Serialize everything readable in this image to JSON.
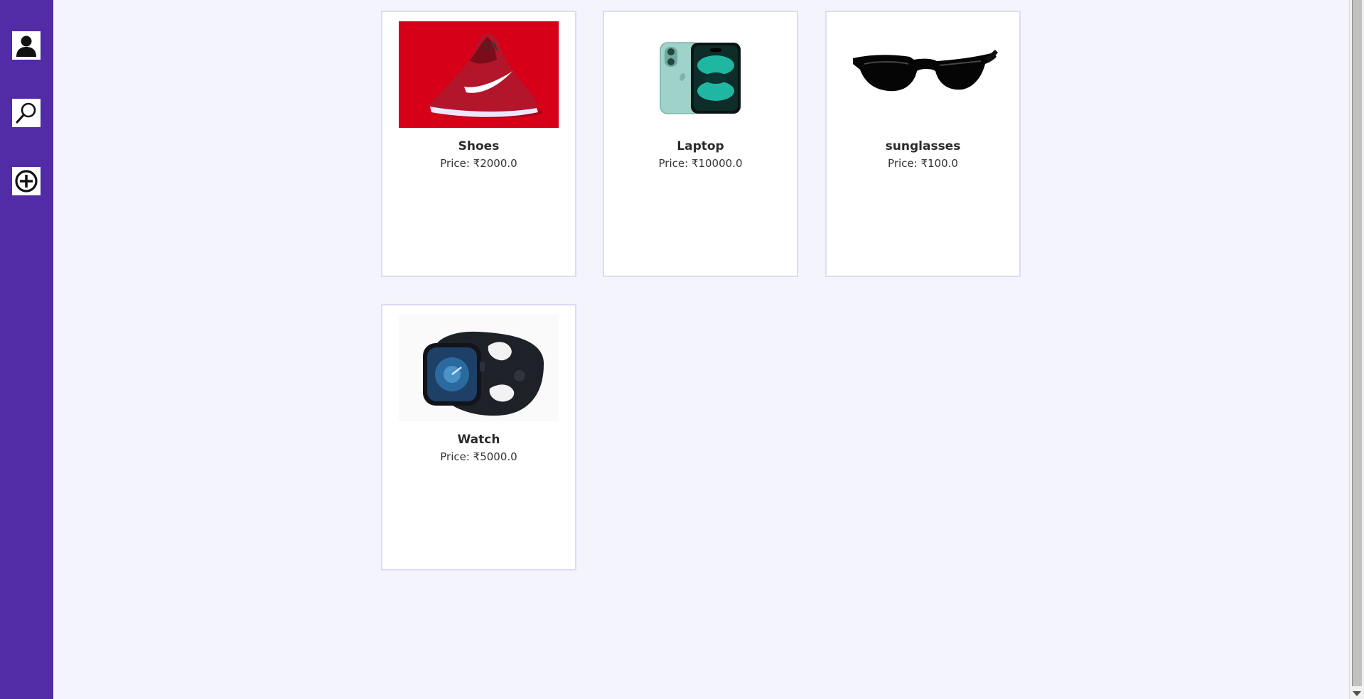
{
  "sidebar": {
    "accent_color": "#522ba7",
    "buttons": [
      {
        "icon": "user-icon",
        "name": "profile-button"
      },
      {
        "icon": "search-icon",
        "name": "search-button"
      },
      {
        "icon": "add-icon",
        "name": "add-product-button"
      }
    ]
  },
  "products": [
    {
      "name": "Shoes",
      "price": "Price: ₹2000.0",
      "image": "red-sneaker-image"
    },
    {
      "name": "Laptop",
      "price": "Price: ₹10000.0",
      "image": "phone-image"
    },
    {
      "name": "sunglasses",
      "price": "Price: ₹100.0",
      "image": "sunglasses-image"
    },
    {
      "name": "Watch",
      "price": "Price: ₹5000.0",
      "image": "smartwatch-image"
    }
  ]
}
